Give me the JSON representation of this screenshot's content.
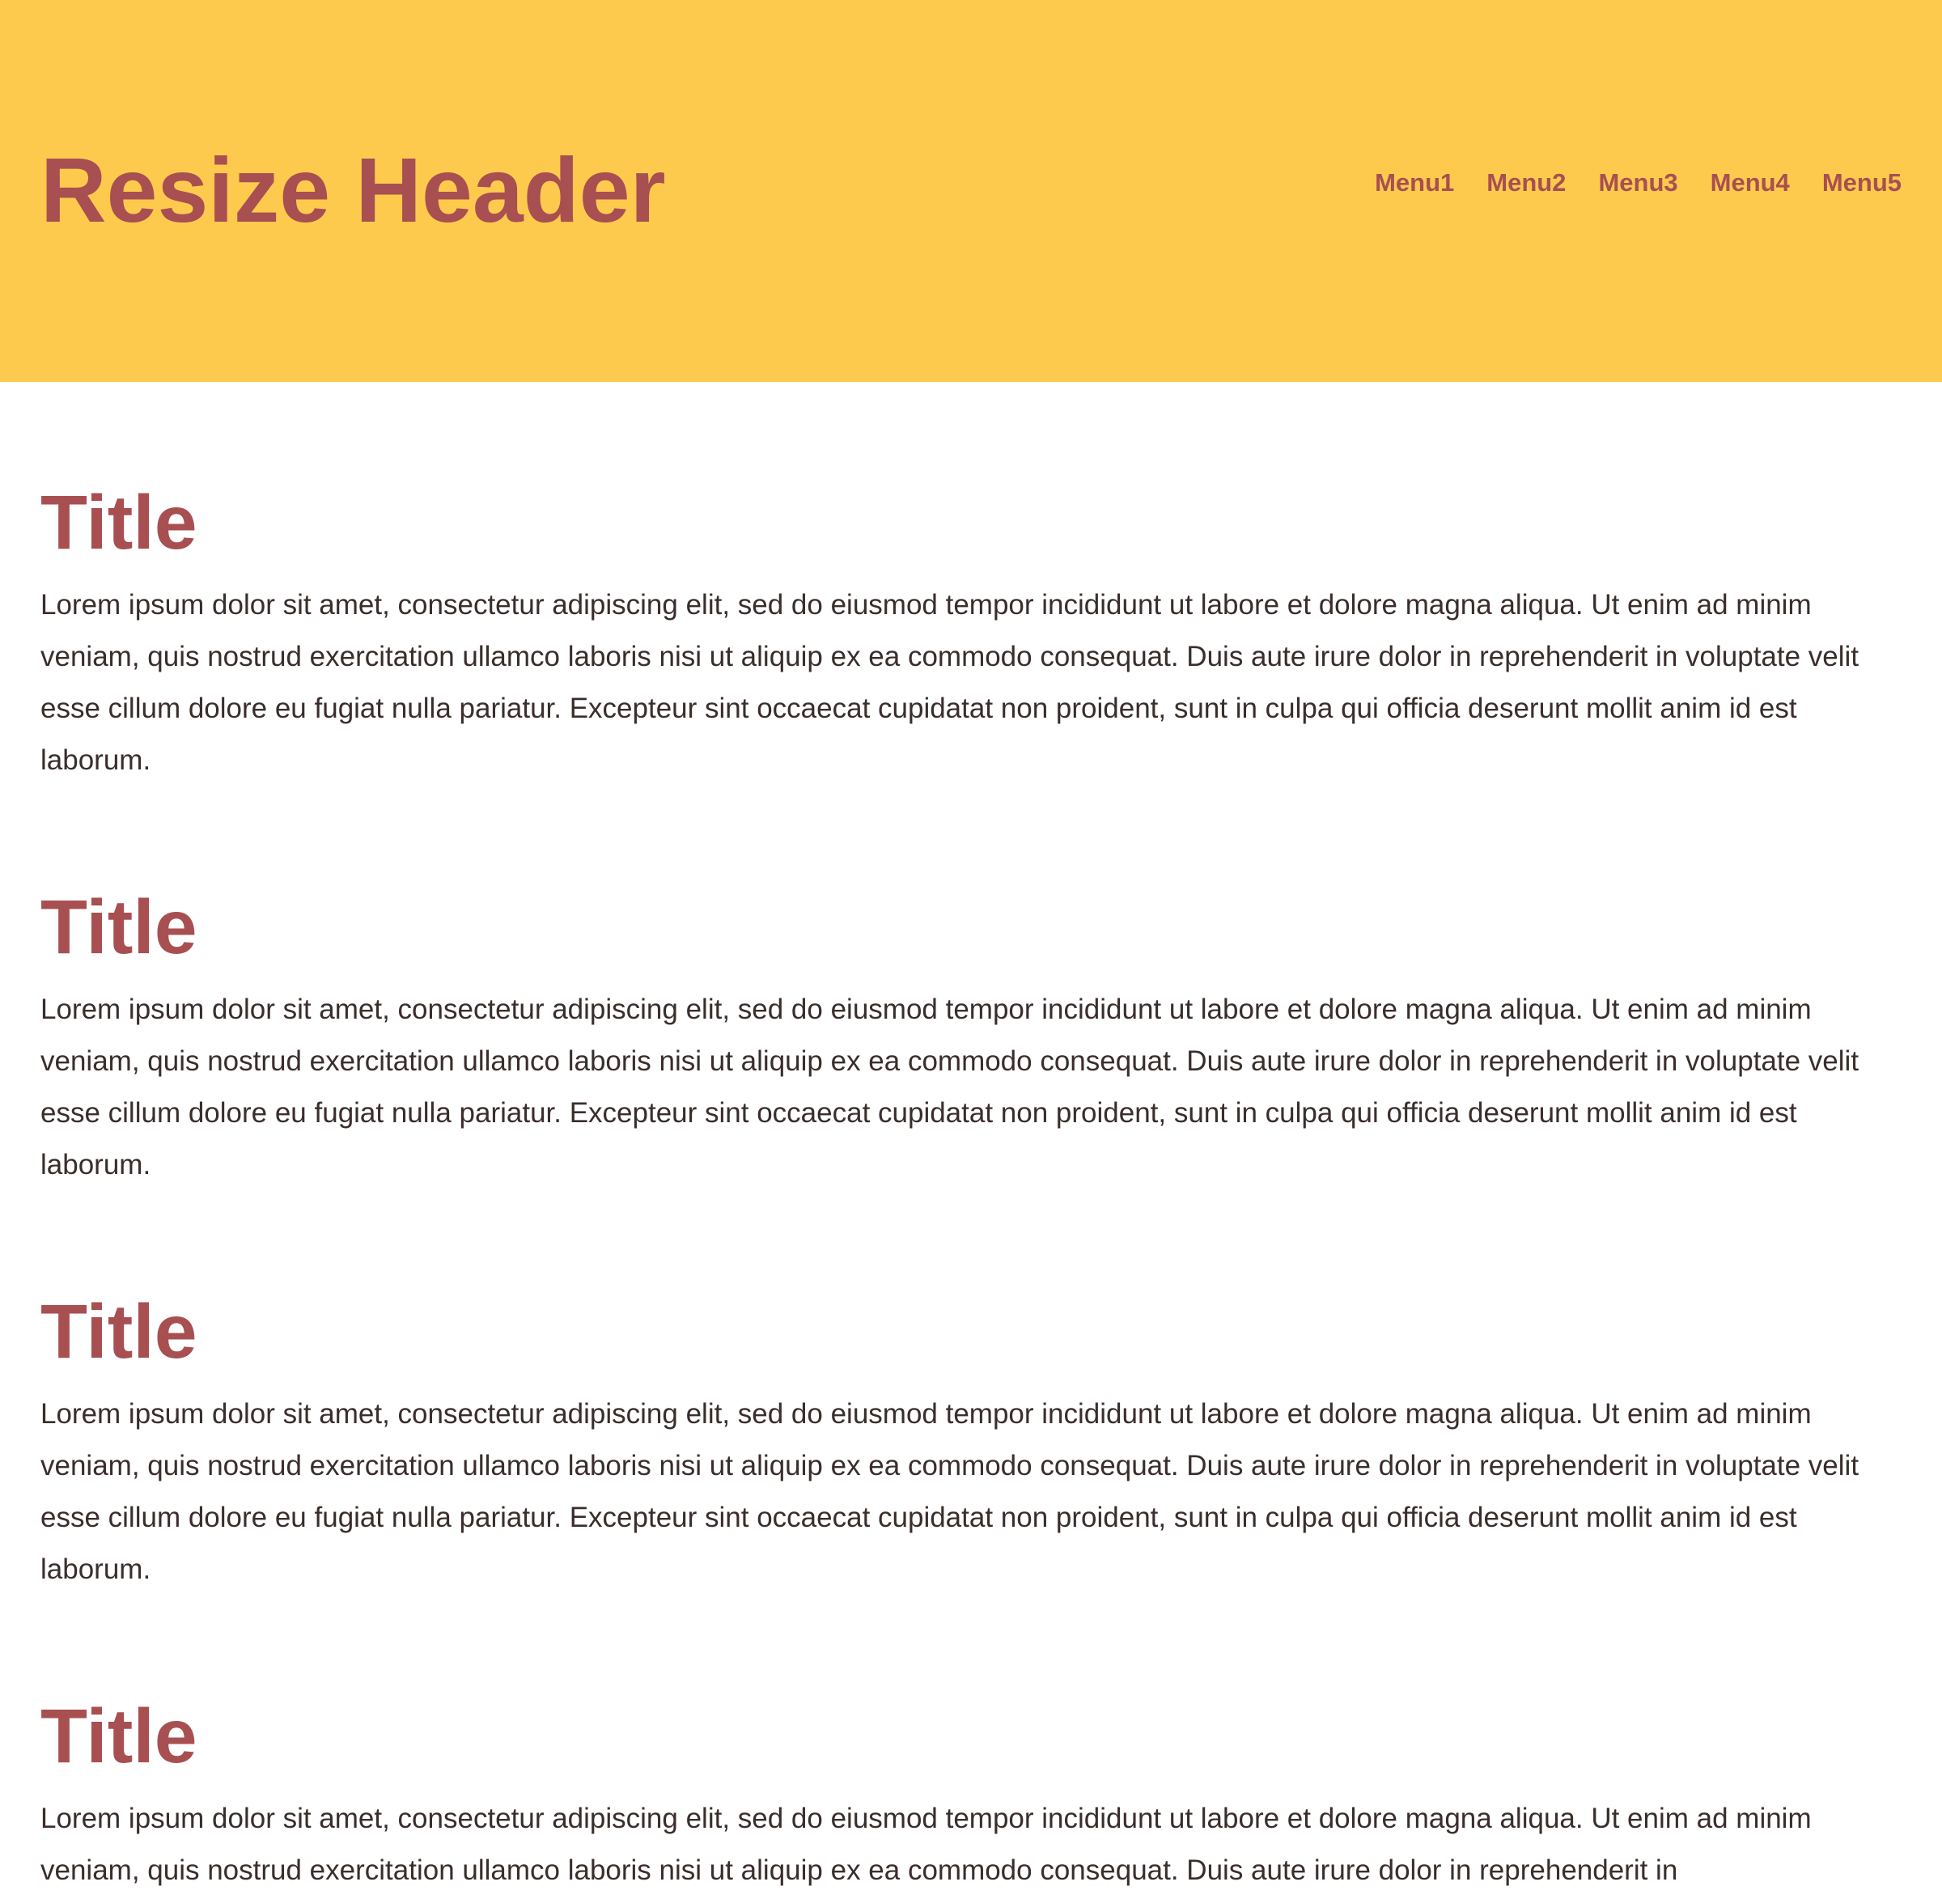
{
  "header": {
    "title": "Resize Header",
    "background_color": "#fdca4d",
    "text_color": "#a84f52",
    "menu": [
      {
        "label": "Menu1"
      },
      {
        "label": "Menu2"
      },
      {
        "label": "Menu3"
      },
      {
        "label": "Menu4"
      },
      {
        "label": "Menu5"
      }
    ]
  },
  "sections": [
    {
      "title": "Title",
      "body": "Lorem ipsum dolor sit amet, consectetur adipiscing elit, sed do eiusmod tempor incididunt ut labore et dolore magna aliqua. Ut enim ad minim veniam, quis nostrud exercitation ullamco laboris nisi ut aliquip ex ea commodo consequat. Duis aute irure dolor in reprehenderit in voluptate velit esse cillum dolore eu fugiat nulla pariatur. Excepteur sint occaecat cupidatat non proident, sunt in culpa qui officia deserunt mollit anim id est laborum."
    },
    {
      "title": "Title",
      "body": "Lorem ipsum dolor sit amet, consectetur adipiscing elit, sed do eiusmod tempor incididunt ut labore et dolore magna aliqua. Ut enim ad minim veniam, quis nostrud exercitation ullamco laboris nisi ut aliquip ex ea commodo consequat. Duis aute irure dolor in reprehenderit in voluptate velit esse cillum dolore eu fugiat nulla pariatur. Excepteur sint occaecat cupidatat non proident, sunt in culpa qui officia deserunt mollit anim id est laborum."
    },
    {
      "title": "Title",
      "body": "Lorem ipsum dolor sit amet, consectetur adipiscing elit, sed do eiusmod tempor incididunt ut labore et dolore magna aliqua. Ut enim ad minim veniam, quis nostrud exercitation ullamco laboris nisi ut aliquip ex ea commodo consequat. Duis aute irure dolor in reprehenderit in voluptate velit esse cillum dolore eu fugiat nulla pariatur. Excepteur sint occaecat cupidatat non proident, sunt in culpa qui officia deserunt mollit anim id est laborum."
    },
    {
      "title": "Title",
      "body": "Lorem ipsum dolor sit amet, consectetur adipiscing elit, sed do eiusmod tempor incididunt ut labore et dolore magna aliqua. Ut enim ad minim veniam, quis nostrud exercitation ullamco laboris nisi ut aliquip ex ea commodo consequat. Duis aute irure dolor in reprehenderit in"
    }
  ]
}
